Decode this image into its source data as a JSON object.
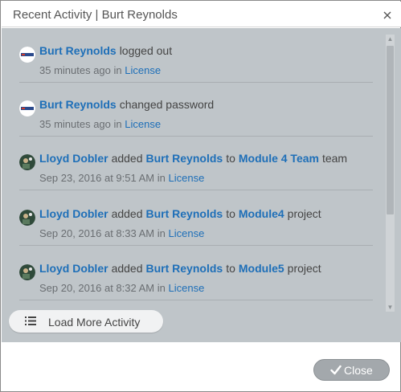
{
  "dialog": {
    "title": "Recent Activity | Burt Reynolds",
    "close_icon": "close-icon"
  },
  "activities": [
    {
      "avatar": "company-logo",
      "actor": "Burt Reynolds",
      "verb": "logged out",
      "time": "35 minutes ago",
      "in_word": "in",
      "context": "License"
    },
    {
      "avatar": "company-logo",
      "actor": "Burt Reynolds",
      "verb": "changed password",
      "time": "35 minutes ago",
      "in_word": "in",
      "context": "License"
    },
    {
      "avatar": "user-photo",
      "actor": "Lloyd Dobler",
      "verb": "added",
      "target": "Burt Reynolds",
      "prep": "to",
      "object": "Module 4 Team",
      "object_type": "team",
      "time": "Sep 23, 2016 at 9:51 AM",
      "in_word": "in",
      "context": "License"
    },
    {
      "avatar": "user-photo",
      "actor": "Lloyd Dobler",
      "verb": "added",
      "target": "Burt Reynolds",
      "prep": "to",
      "object": "Module4",
      "object_type": "project",
      "time": "Sep 20, 2016 at 8:33 AM",
      "in_word": "in",
      "context": "License"
    },
    {
      "avatar": "user-photo",
      "actor": "Lloyd Dobler",
      "verb": "added",
      "target": "Burt Reynolds",
      "prep": "to",
      "object": "Module5",
      "object_type": "project",
      "time": "Sep 20, 2016 at 8:32 AM",
      "in_word": "in",
      "context": "License"
    }
  ],
  "load_more": {
    "label": "Load More Activity",
    "icon": "list-icon"
  },
  "footer": {
    "close_label": "Close",
    "close_icon": "check-icon"
  },
  "colors": {
    "link": "#1e6fb8",
    "panel_bg": "#bfc5c9",
    "close_button_bg": "#a3a8ac"
  }
}
